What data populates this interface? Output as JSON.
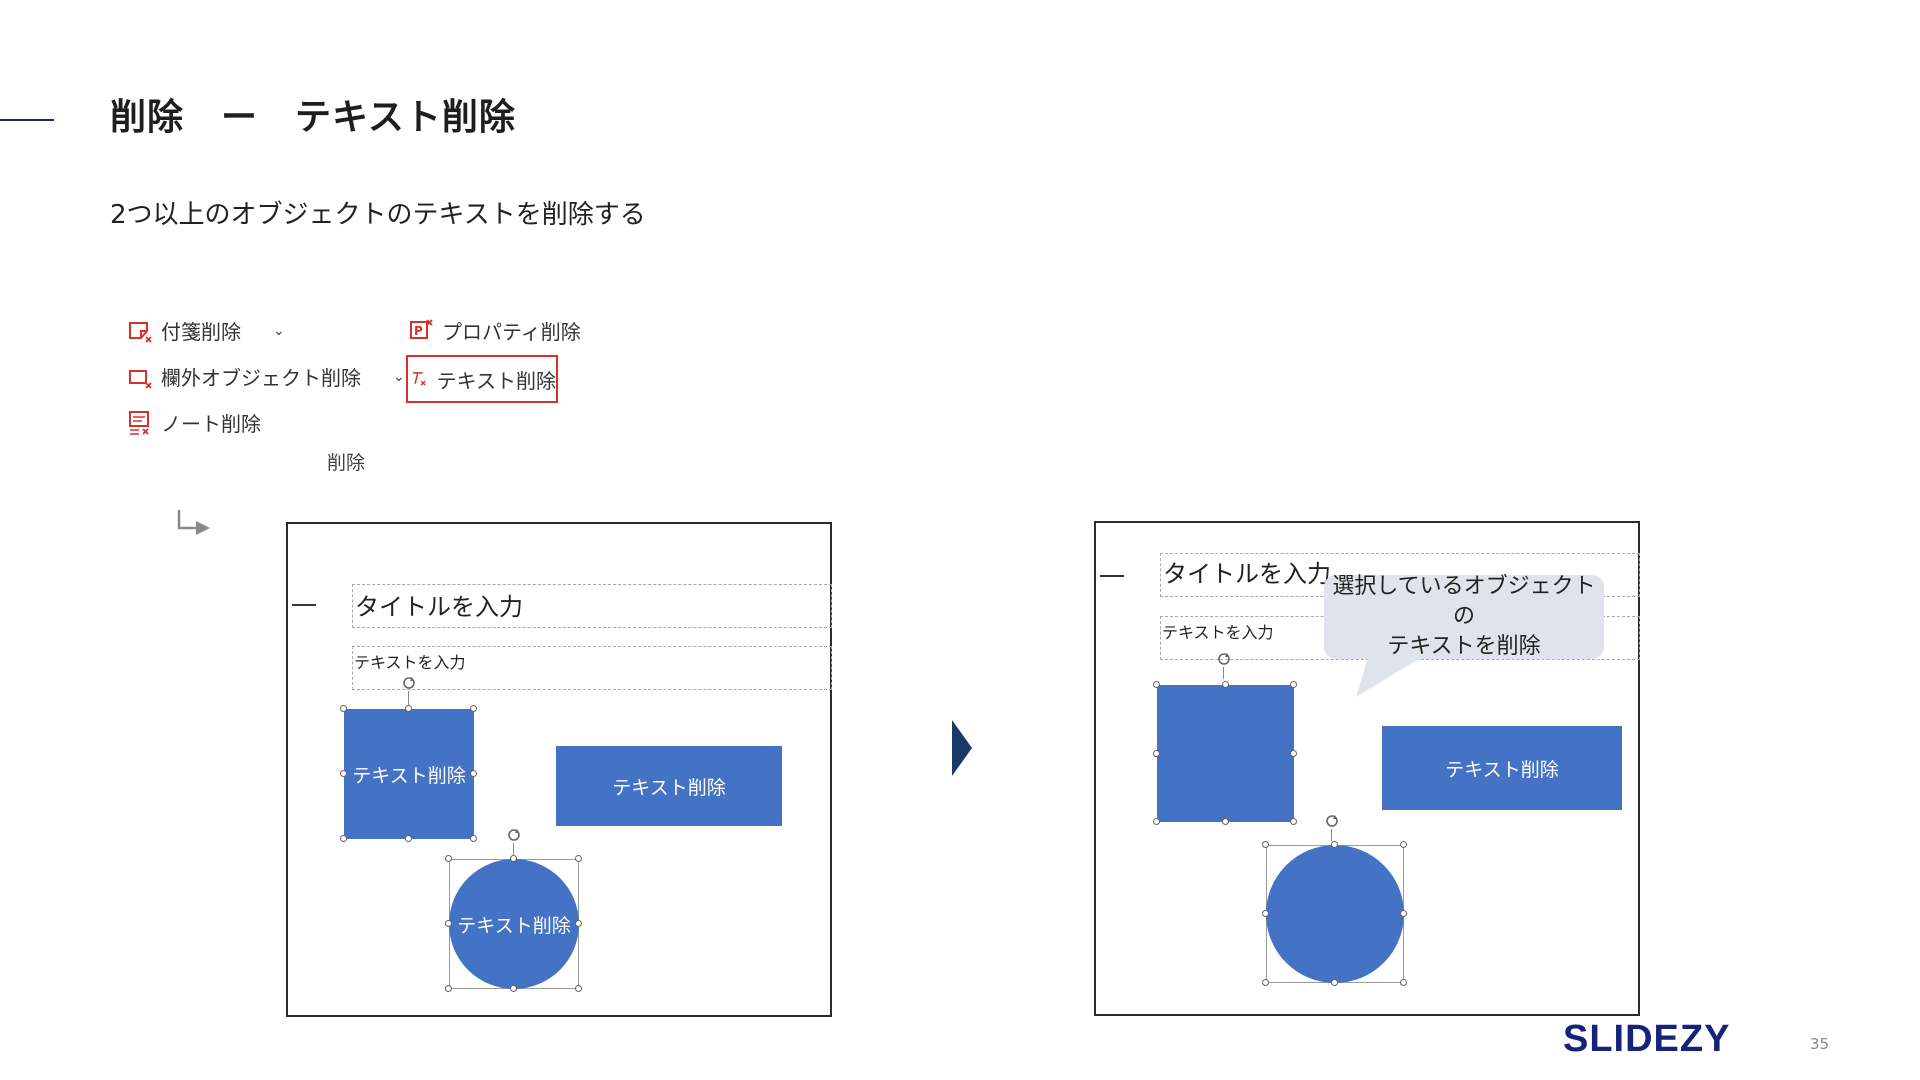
{
  "page": {
    "title": "削除　ー　テキスト削除",
    "subtitle": "2つ以上のオブジェクトのテキストを削除する",
    "page_number": "35",
    "logo": "SLIDEZY"
  },
  "ribbon": {
    "sticky_delete": "付箋削除",
    "outside_objects_delete": "欄外オブジェクト削除",
    "notes_delete": "ノート削除",
    "property_delete": "プロパティ削除",
    "text_delete": "テキスト削除",
    "group_label": "削除",
    "icons": {
      "sticky": "sticky-note-delete-icon",
      "outside": "outside-object-delete-icon",
      "notes": "notes-delete-icon",
      "property": "property-delete-icon",
      "text": "text-clear-format-icon"
    },
    "accent": "#d6322a"
  },
  "before_slide": {
    "title_placeholder": "タイトルを入力",
    "text_placeholder": "テキストを入力",
    "square_text": "テキスト削除",
    "rect_text": "テキスト削除",
    "circle_text": "テキスト削除"
  },
  "after_slide": {
    "title_placeholder": "タイトルを入力",
    "text_placeholder": "テキストを入力",
    "rect_text": "テキスト削除",
    "callout_line1": "選択しているオブジェクトの",
    "callout_line2": "テキストを削除"
  },
  "colors": {
    "shape_fill": "#4472c4",
    "logo": "#16237a",
    "arrow": "#1a3a6b"
  }
}
